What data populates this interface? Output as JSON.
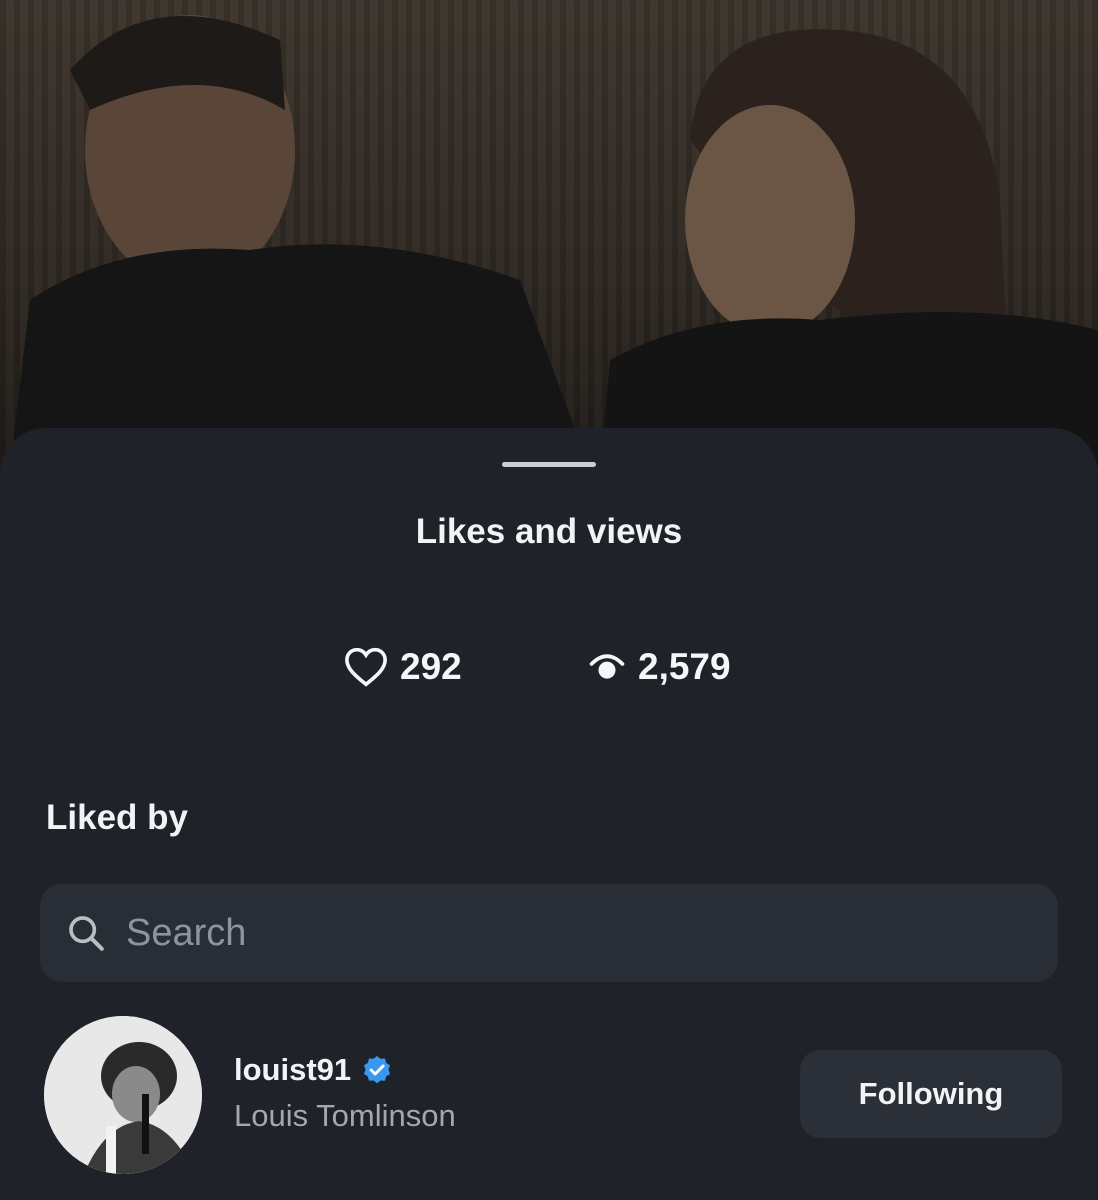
{
  "sheet": {
    "title": "Likes and views"
  },
  "stats": {
    "likes_icon": "heart-icon",
    "likes": "292",
    "views_icon": "eye-icon",
    "views": "2,579"
  },
  "liked_by": {
    "label": "Liked by",
    "search_placeholder": "Search",
    "search_icon": "search-icon"
  },
  "users": [
    {
      "username": "louist91",
      "verified": true,
      "full_name": "Louis Tomlinson",
      "button_label": "Following"
    }
  ],
  "colors": {
    "sheet_background": "#1f2229",
    "search_background": "#292d35",
    "verified_badge": "#3897f0",
    "button_background": "#2b2f37"
  }
}
